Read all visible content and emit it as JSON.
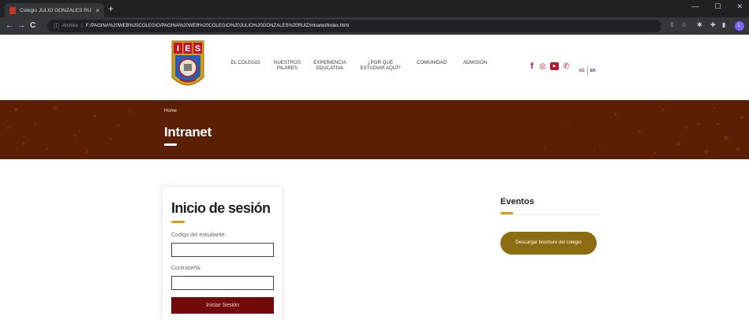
{
  "browser": {
    "tab_title": "Colegio JULIO GONZALES RUIZ",
    "tab_close": "×",
    "new_tab": "+",
    "controls": {
      "minimize": "—",
      "maximize": "☐",
      "close": "✕"
    },
    "back": "←",
    "forward": "→",
    "reload": "C",
    "address_scheme": "Archivo",
    "address_url": "F:/PAGINA%20WEB%20COLEGIO/PAGINA%20WEB%20COLEGIO%20JULIO%20GONZALES%20RUIZ/intranet/index.html",
    "profile_initial": "L"
  },
  "header": {
    "logo_letters": [
      "I",
      "E",
      "S"
    ],
    "nav": [
      {
        "label": "EL COLEGIO"
      },
      {
        "label": "NUESTROS\nPILARES"
      },
      {
        "label": "EXPERIENCIA\nEDUCATIVA"
      },
      {
        "label": "¿POR QUÉ\nESTUDIAR AQUÍ?"
      },
      {
        "label": "COMUNIDAD"
      },
      {
        "label": "ADMISIÓN"
      }
    ],
    "social": [
      {
        "icon": "facebook-icon",
        "glyph": "f",
        "color": "#c0152b"
      },
      {
        "icon": "instagram-icon",
        "glyph": "◎",
        "color": "#c0152b"
      },
      {
        "icon": "youtube-icon",
        "glyph": "▶",
        "color": "#c0152b"
      },
      {
        "icon": "whatsapp-icon",
        "glyph": "✆",
        "color": "#c0152b"
      }
    ],
    "lang_es": "ES",
    "lang_en": "EN"
  },
  "banner": {
    "breadcrumb": "Home",
    "title": "Intranet"
  },
  "login": {
    "title": "Inicio de sesión",
    "student_code_label": "Codigo del estudiante:",
    "student_code_value": "",
    "password_label": "Contraseña:",
    "password_value": "",
    "submit_label": "Iniciar Sesión"
  },
  "events": {
    "title": "Eventos",
    "brochure_button": "Descargar brochure del colegio"
  },
  "colors": {
    "banner": "#5a1f05",
    "accent_gold": "#d4a017",
    "login_button": "#730a0a",
    "brochure_button": "#8c6d11"
  }
}
